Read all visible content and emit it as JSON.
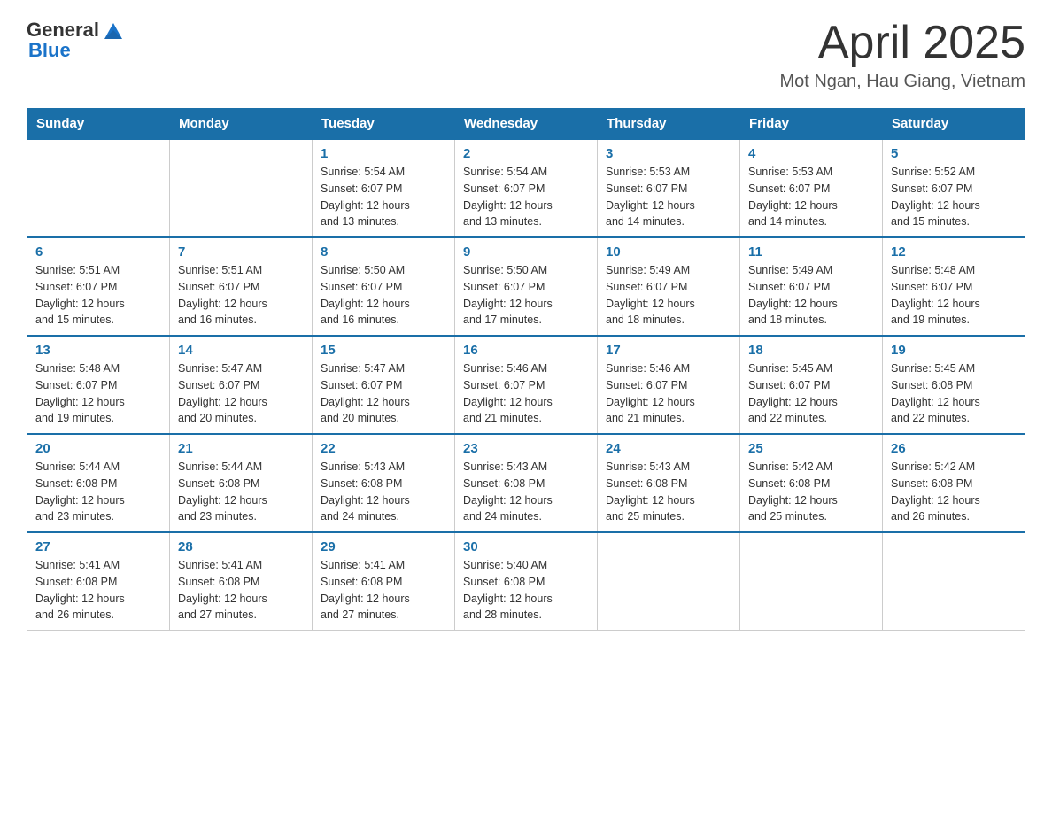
{
  "header": {
    "logo_general": "General",
    "logo_blue": "Blue",
    "month_title": "April 2025",
    "subtitle": "Mot Ngan, Hau Giang, Vietnam"
  },
  "weekdays": [
    "Sunday",
    "Monday",
    "Tuesday",
    "Wednesday",
    "Thursday",
    "Friday",
    "Saturday"
  ],
  "weeks": [
    [
      {
        "day": "",
        "info": ""
      },
      {
        "day": "",
        "info": ""
      },
      {
        "day": "1",
        "info": "Sunrise: 5:54 AM\nSunset: 6:07 PM\nDaylight: 12 hours\nand 13 minutes."
      },
      {
        "day": "2",
        "info": "Sunrise: 5:54 AM\nSunset: 6:07 PM\nDaylight: 12 hours\nand 13 minutes."
      },
      {
        "day": "3",
        "info": "Sunrise: 5:53 AM\nSunset: 6:07 PM\nDaylight: 12 hours\nand 14 minutes."
      },
      {
        "day": "4",
        "info": "Sunrise: 5:53 AM\nSunset: 6:07 PM\nDaylight: 12 hours\nand 14 minutes."
      },
      {
        "day": "5",
        "info": "Sunrise: 5:52 AM\nSunset: 6:07 PM\nDaylight: 12 hours\nand 15 minutes."
      }
    ],
    [
      {
        "day": "6",
        "info": "Sunrise: 5:51 AM\nSunset: 6:07 PM\nDaylight: 12 hours\nand 15 minutes."
      },
      {
        "day": "7",
        "info": "Sunrise: 5:51 AM\nSunset: 6:07 PM\nDaylight: 12 hours\nand 16 minutes."
      },
      {
        "day": "8",
        "info": "Sunrise: 5:50 AM\nSunset: 6:07 PM\nDaylight: 12 hours\nand 16 minutes."
      },
      {
        "day": "9",
        "info": "Sunrise: 5:50 AM\nSunset: 6:07 PM\nDaylight: 12 hours\nand 17 minutes."
      },
      {
        "day": "10",
        "info": "Sunrise: 5:49 AM\nSunset: 6:07 PM\nDaylight: 12 hours\nand 18 minutes."
      },
      {
        "day": "11",
        "info": "Sunrise: 5:49 AM\nSunset: 6:07 PM\nDaylight: 12 hours\nand 18 minutes."
      },
      {
        "day": "12",
        "info": "Sunrise: 5:48 AM\nSunset: 6:07 PM\nDaylight: 12 hours\nand 19 minutes."
      }
    ],
    [
      {
        "day": "13",
        "info": "Sunrise: 5:48 AM\nSunset: 6:07 PM\nDaylight: 12 hours\nand 19 minutes."
      },
      {
        "day": "14",
        "info": "Sunrise: 5:47 AM\nSunset: 6:07 PM\nDaylight: 12 hours\nand 20 minutes."
      },
      {
        "day": "15",
        "info": "Sunrise: 5:47 AM\nSunset: 6:07 PM\nDaylight: 12 hours\nand 20 minutes."
      },
      {
        "day": "16",
        "info": "Sunrise: 5:46 AM\nSunset: 6:07 PM\nDaylight: 12 hours\nand 21 minutes."
      },
      {
        "day": "17",
        "info": "Sunrise: 5:46 AM\nSunset: 6:07 PM\nDaylight: 12 hours\nand 21 minutes."
      },
      {
        "day": "18",
        "info": "Sunrise: 5:45 AM\nSunset: 6:07 PM\nDaylight: 12 hours\nand 22 minutes."
      },
      {
        "day": "19",
        "info": "Sunrise: 5:45 AM\nSunset: 6:08 PM\nDaylight: 12 hours\nand 22 minutes."
      }
    ],
    [
      {
        "day": "20",
        "info": "Sunrise: 5:44 AM\nSunset: 6:08 PM\nDaylight: 12 hours\nand 23 minutes."
      },
      {
        "day": "21",
        "info": "Sunrise: 5:44 AM\nSunset: 6:08 PM\nDaylight: 12 hours\nand 23 minutes."
      },
      {
        "day": "22",
        "info": "Sunrise: 5:43 AM\nSunset: 6:08 PM\nDaylight: 12 hours\nand 24 minutes."
      },
      {
        "day": "23",
        "info": "Sunrise: 5:43 AM\nSunset: 6:08 PM\nDaylight: 12 hours\nand 24 minutes."
      },
      {
        "day": "24",
        "info": "Sunrise: 5:43 AM\nSunset: 6:08 PM\nDaylight: 12 hours\nand 25 minutes."
      },
      {
        "day": "25",
        "info": "Sunrise: 5:42 AM\nSunset: 6:08 PM\nDaylight: 12 hours\nand 25 minutes."
      },
      {
        "day": "26",
        "info": "Sunrise: 5:42 AM\nSunset: 6:08 PM\nDaylight: 12 hours\nand 26 minutes."
      }
    ],
    [
      {
        "day": "27",
        "info": "Sunrise: 5:41 AM\nSunset: 6:08 PM\nDaylight: 12 hours\nand 26 minutes."
      },
      {
        "day": "28",
        "info": "Sunrise: 5:41 AM\nSunset: 6:08 PM\nDaylight: 12 hours\nand 27 minutes."
      },
      {
        "day": "29",
        "info": "Sunrise: 5:41 AM\nSunset: 6:08 PM\nDaylight: 12 hours\nand 27 minutes."
      },
      {
        "day": "30",
        "info": "Sunrise: 5:40 AM\nSunset: 6:08 PM\nDaylight: 12 hours\nand 28 minutes."
      },
      {
        "day": "",
        "info": ""
      },
      {
        "day": "",
        "info": ""
      },
      {
        "day": "",
        "info": ""
      }
    ]
  ]
}
